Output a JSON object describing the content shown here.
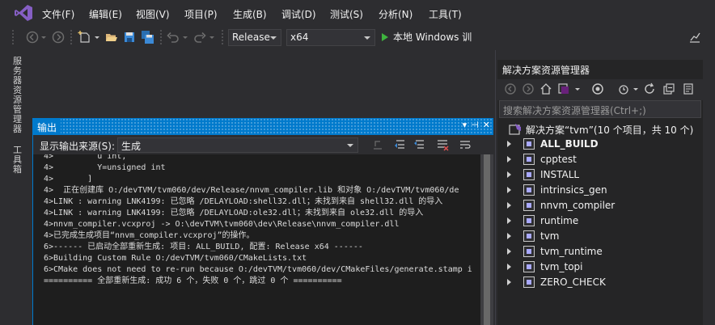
{
  "menubar": {
    "items": [
      "文件(F)",
      "编辑(E)",
      "视图(V)",
      "项目(P)",
      "生成(B)",
      "调试(D)",
      "测试(S)",
      "分析(N)",
      "工具(T)"
    ]
  },
  "toolbar": {
    "configuration": "Release",
    "platform": "x64",
    "run_label": "本地 Windows 训"
  },
  "left_tabs": {
    "server_explorer": "服务器资源管理器",
    "toolbox": "工具箱"
  },
  "output": {
    "title": "输出",
    "source_label": "显示输出来源(S):",
    "source_value": "生成",
    "lines": [
      "4>         u int,",
      "4>         Y=unsigned int",
      "4>       ]",
      "4>  正在创建库 O:/devTVM/tvm060/dev/Release/nnvm_compiler.lib 和对象 O:/devTVM/tvm060/de",
      "4>LINK : warning LNK4199: 已忽略 /DELAYLOAD:shell32.dll；未找到来自 shell32.dll 的导入",
      "4>LINK : warning LNK4199: 已忽略 /DELAYLOAD:ole32.dll；未找到来自 ole32.dll 的导入",
      "4>nnvm_compiler.vcxproj -> O:\\devTVM\\tvm060\\dev\\Release\\nnvm_compiler.dll",
      "4>已完成生成项目“nnvm_compiler.vcxproj”的操作。",
      "6>------ 已启动全部重新生成: 项目: ALL_BUILD, 配置: Release x64 ------",
      "6>Building Custom Rule O:/devTVM/tvm060/CMakeLists.txt",
      "6>CMake does not need to re-run because O:/devTVM/tvm060/dev/CMakeFiles/generate.stamp i",
      "========== 全部重新生成: 成功 6 个，失败 0 个，跳过 0 个 =========="
    ]
  },
  "solution_explorer": {
    "title": "解决方案资源管理器",
    "search_placeholder": "搜索解决方案资源管理器(Ctrl+;)",
    "solution_label": "解决方案“tvm”(10 个项目，共 10 个)",
    "projects": [
      "ALL_BUILD",
      "cpptest",
      "INSTALL",
      "intrinsics_gen",
      "nnvm_compiler",
      "runtime",
      "tvm",
      "tvm_runtime",
      "tvm_topi",
      "ZERO_CHECK"
    ],
    "selected_project": "ALL_BUILD"
  },
  "colors": {
    "accent": "#007acc",
    "background": "#2d2d30",
    "output_bg": "#1e1e1e",
    "vs_logo": "#865fc5"
  },
  "icons": [
    "vs-logo-icon",
    "back-icon",
    "forward-icon",
    "new-project-icon",
    "open-icon",
    "save-icon",
    "save-all-icon",
    "undo-icon",
    "redo-icon",
    "play-icon",
    "feedback-icon",
    "home-icon",
    "refresh-icon",
    "collapse-icon",
    "properties-icon",
    "solution-icon",
    "project-icon",
    "expand-arrow-icon"
  ]
}
